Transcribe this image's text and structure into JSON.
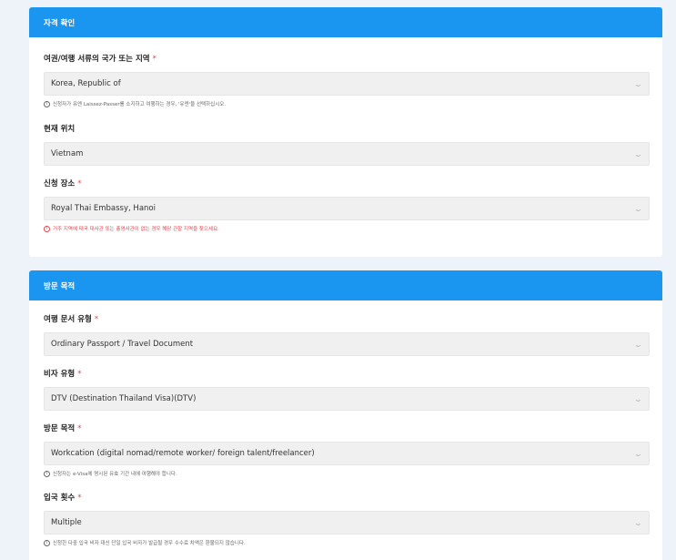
{
  "section1": {
    "title": "자격 확인",
    "fields": [
      {
        "label": "여권/여행 서류의 국가 또는 지역",
        "required": true,
        "value": "Korea, Republic of",
        "hint": "신청자가 유엔 Laissez-Passer를 소지하고 여행하는 경우, '유엔'을 선택하십시오.",
        "hint_color": "#666666"
      },
      {
        "label": "현재 위치",
        "required": false,
        "value": "Vietnam",
        "hint": ""
      },
      {
        "label": "신청 장소",
        "required": true,
        "value": "Royal Thai Embassy, Hanoi",
        "hint": "거주 지역에 태국 대사관 또는 총영사관이 없는 경우 해당 관할 지역을 찾으세요.",
        "hint_color": "#e0454e"
      }
    ]
  },
  "section2": {
    "title": "방문 목적",
    "fields": [
      {
        "label": "여행 문서 유형",
        "required": true,
        "value": "Ordinary Passport / Travel Document",
        "hint": ""
      },
      {
        "label": "비자 유형",
        "required": true,
        "value": "DTV (Destination Thailand Visa)(DTV)",
        "hint": ""
      },
      {
        "label": "방문 목적",
        "required": true,
        "value": "Workcation (digital nomad/remote worker/ foreign talent/freelancer)",
        "hint": "신청자는 e-Visa에 명시된 유효 기간 내에 여행해야 합니다.",
        "hint_color": "#666666"
      },
      {
        "label": "입국 횟수",
        "required": true,
        "value": "Multiple",
        "hint": "신청한 다중 입국 비자 대신 단일 입국 비자가 발급될 경우 수수료 차액은 환불되지 않습니다.",
        "hint_color": "#666666"
      }
    ]
  },
  "required_mark": "*",
  "colors": {
    "header": "#1a95f0",
    "background": "#eef3f9",
    "required": "#e0454e"
  },
  "icons": {
    "dropdown": "chevron-down-icon",
    "hint": "info-circle-icon"
  }
}
